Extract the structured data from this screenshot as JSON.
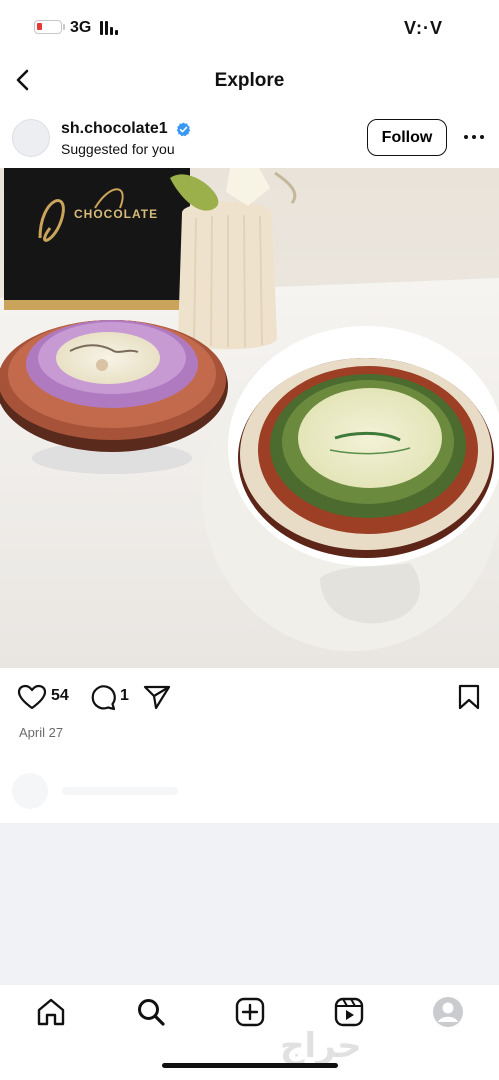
{
  "status_bar": {
    "network": "3G",
    "time": "V:·V"
  },
  "header": {
    "title": "Explore"
  },
  "post": {
    "username": "sh.chocolate1",
    "subtitle": "Suggested for you",
    "follow_label": "Follow",
    "likes": "54",
    "comments": "1",
    "date": "April 27"
  },
  "photo": {
    "sign_text": "CHOCOLATE"
  },
  "watermark": "حراج",
  "colors": {
    "verified": "#3897f0",
    "battery_low": "#e53935",
    "grey_area": "#f1f2f5"
  },
  "icons": {
    "back": "chevron-left-icon",
    "more": "more-dots-icon",
    "like": "heart-icon",
    "comment": "comment-icon",
    "share": "send-icon",
    "save": "bookmark-icon",
    "tabs": [
      "home-icon",
      "search-icon",
      "create-icon",
      "reels-icon",
      "profile-icon"
    ]
  }
}
